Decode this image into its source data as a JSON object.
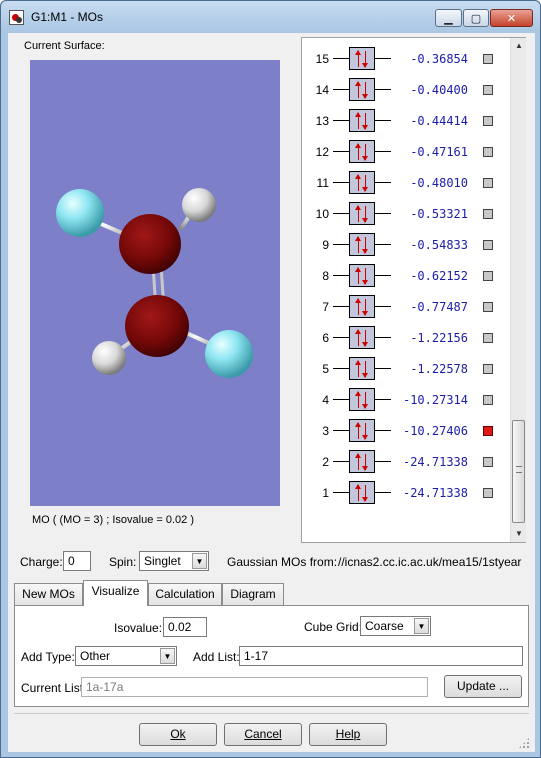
{
  "window": {
    "title": "G1:M1 - MOs",
    "minimize_icon": "minimize-icon",
    "maximize_icon": "maximize-icon",
    "close_icon": "close-icon"
  },
  "surface": {
    "label": "Current Surface:",
    "caption": "MO ( (MO = 3) ; Isovalue = 0.02 )"
  },
  "orbitals": [
    {
      "number": "15",
      "energy": "-0.36854",
      "selected": false
    },
    {
      "number": "14",
      "energy": "-0.40400",
      "selected": false
    },
    {
      "number": "13",
      "energy": "-0.44414",
      "selected": false
    },
    {
      "number": "12",
      "energy": "-0.47161",
      "selected": false
    },
    {
      "number": "11",
      "energy": "-0.48010",
      "selected": false
    },
    {
      "number": "10",
      "energy": "-0.53321",
      "selected": false
    },
    {
      "number": "9",
      "energy": "-0.54833",
      "selected": false
    },
    {
      "number": "8",
      "energy": "-0.62152",
      "selected": false
    },
    {
      "number": "7",
      "energy": "-0.77487",
      "selected": false
    },
    {
      "number": "6",
      "energy": "-1.22156",
      "selected": false
    },
    {
      "number": "5",
      "energy": "-1.22578",
      "selected": false
    },
    {
      "number": "4",
      "energy": "-10.27314",
      "selected": false
    },
    {
      "number": "3",
      "energy": "-10.27406",
      "selected": true
    },
    {
      "number": "2",
      "energy": "-24.71338",
      "selected": false
    },
    {
      "number": "1",
      "energy": "-24.71338",
      "selected": false
    }
  ],
  "controls": {
    "charge_label": "Charge:",
    "charge_value": "0",
    "spin_label": "Spin:",
    "spin_value": "Singlet",
    "source_label": "Gaussian MOs from:",
    "source_value": "//icnas2.cc.ic.ac.uk/mea15/1styear"
  },
  "tabs": [
    {
      "label": "New MOs",
      "active": false
    },
    {
      "label": "Visualize",
      "active": true
    },
    {
      "label": "Calculation",
      "active": false
    },
    {
      "label": "Diagram",
      "active": false
    }
  ],
  "visualize": {
    "isovalue_label": "Isovalue:",
    "isovalue_value": "0.02",
    "cube_grid_label": "Cube Grid:",
    "cube_grid_value": "Coarse",
    "add_type_label": "Add Type:",
    "add_type_value": "Other",
    "add_list_label": "Add List:",
    "add_list_value": "1-17",
    "current_list_label": "Current List:",
    "current_list_value": "1a-17a",
    "update_label": "Update ..."
  },
  "buttons": {
    "ok": "Ok",
    "cancel": "Cancel",
    "help": "Help"
  },
  "colors": {
    "viewport_bg": "#7d7fc9",
    "selected_mo": "#e01818",
    "energy_text": "#1c1caa",
    "electron_arrow": "#d00000"
  }
}
